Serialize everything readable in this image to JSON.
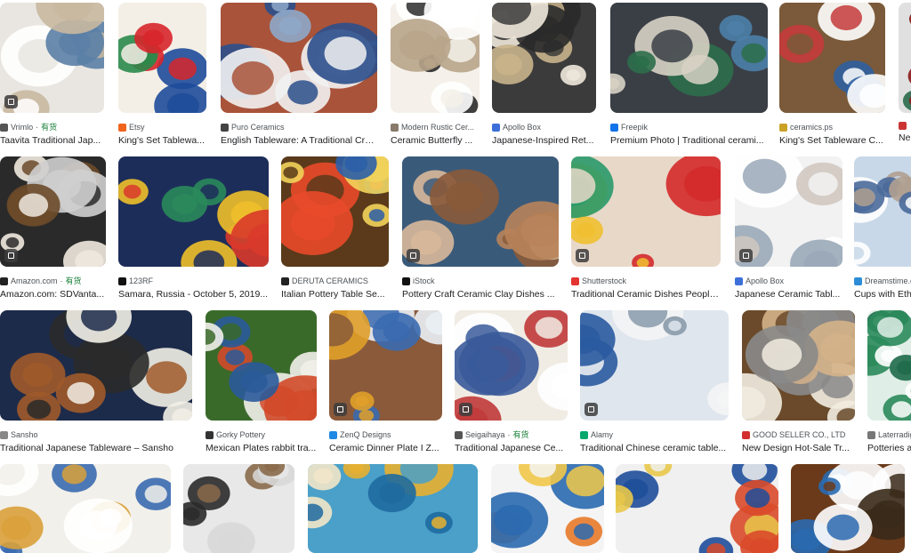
{
  "results": [
    {
      "source": "Vrimlo",
      "stock": "有货",
      "title": "Taavita Traditional Jap...",
      "fav": "#555555"
    },
    {
      "source": "Etsy",
      "stock": "",
      "title": "King's Set Tablewa...",
      "fav": "#f1641e"
    },
    {
      "source": "Puro Ceramics",
      "stock": "",
      "title": "English Tableware: A Traditional Cra...",
      "fav": "#444444"
    },
    {
      "source": "Modern Rustic Cer...",
      "stock": "",
      "title": "Ceramic Butterfly ...",
      "fav": "#8a7a6a"
    },
    {
      "source": "Apollo Box",
      "stock": "",
      "title": "Japanese-Inspired Ret...",
      "fav": "#3d6fd9"
    },
    {
      "source": "Freepik",
      "stock": "",
      "title": "Premium Photo | Traditional cerami...",
      "fav": "#1273eb"
    },
    {
      "source": "ceramics.ps",
      "stock": "",
      "title": "King's Set Tableware C...",
      "fav": "#c9a227"
    },
    {
      "source": "",
      "stock": "",
      "title": "Ne",
      "fav": "#cc3333"
    },
    {
      "source": "Amazon.com",
      "stock": "有货",
      "title": "Amazon.com: SDVanta...",
      "fav": "#222222"
    },
    {
      "source": "123RF",
      "stock": "",
      "title": "Samara, Russia - October 5, 2019...",
      "fav": "#111111"
    },
    {
      "source": "DERUTA CERAMICS",
      "stock": "",
      "title": "Italian Pottery Table Se...",
      "fav": "#222222"
    },
    {
      "source": "iStock",
      "stock": "",
      "title": "Pottery Craft Ceramic Clay Dishes ...",
      "fav": "#111111"
    },
    {
      "source": "Shutterstock",
      "stock": "",
      "title": "Traditional Ceramic Dishes People...",
      "fav": "#e3342f"
    },
    {
      "source": "Apollo Box",
      "stock": "",
      "title": "Japanese Ceramic Tabl...",
      "fav": "#3d6fd9"
    },
    {
      "source": "Dreamstime.com",
      "stock": "",
      "title": "Cups with Eth",
      "fav": "#2d8cd6"
    },
    {
      "source": "Sansho",
      "stock": "",
      "title": "Traditional Japanese Tableware – Sansho",
      "fav": "#888888"
    },
    {
      "source": "Gorky Pottery",
      "stock": "",
      "title": "Mexican Plates rabbit tra...",
      "fav": "#333333"
    },
    {
      "source": "ZenQ Designs",
      "stock": "",
      "title": "Ceramic Dinner Plate I Z...",
      "fav": "#1e88e5"
    },
    {
      "source": "Seigaihaya",
      "stock": "有货",
      "title": "Traditional Japanese Ce...",
      "fav": "#555555"
    },
    {
      "source": "Alamy",
      "stock": "",
      "title": "Traditional Chinese ceramic table...",
      "fav": "#00a86b"
    },
    {
      "source": "GOOD SELLER CO., LTD",
      "stock": "",
      "title": "New Design Hot-Sale Tr...",
      "fav": "#d32f2f"
    },
    {
      "source": "Laterradig",
      "stock": "",
      "title": "Potteries a",
      "fav": "#777777"
    }
  ]
}
